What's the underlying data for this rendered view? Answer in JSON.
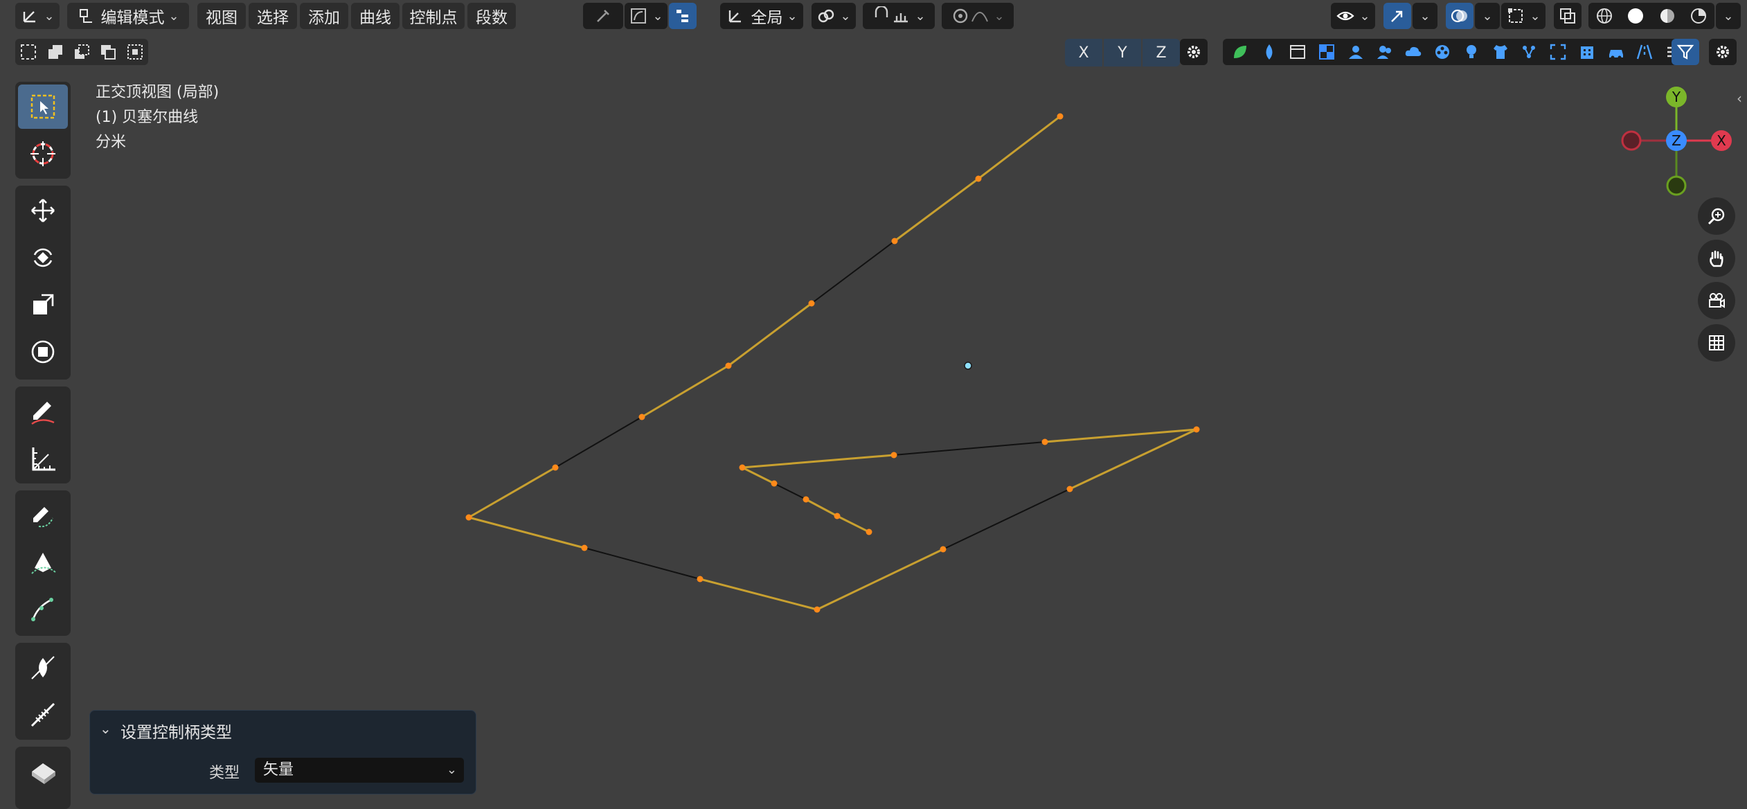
{
  "header": {
    "mode_label": "编辑模式",
    "menus": [
      "视图",
      "选择",
      "添加",
      "曲线",
      "控制点",
      "段数"
    ],
    "transform_orientation": "全局"
  },
  "axis_buttons": [
    "X",
    "Y",
    "Z"
  ],
  "viewport": {
    "view_name": "正交顶视图 (局部)",
    "object_name": "(1) 贝塞尔曲线",
    "unit": "分米"
  },
  "gizmo": {
    "y": "Y",
    "z": "Z",
    "x": "X"
  },
  "operator_panel": {
    "title": "设置控制柄类型",
    "type_label": "类型",
    "type_value": "矢量"
  },
  "colors": {
    "curve_segment": "#c8a030",
    "handle_line": "#111111",
    "control_point": "#ff8a1a",
    "active_tool": "#4b6b8e",
    "axis_x": "#e03a4f",
    "axis_y": "#7bb62a",
    "axis_z": "#3a8cff"
  }
}
